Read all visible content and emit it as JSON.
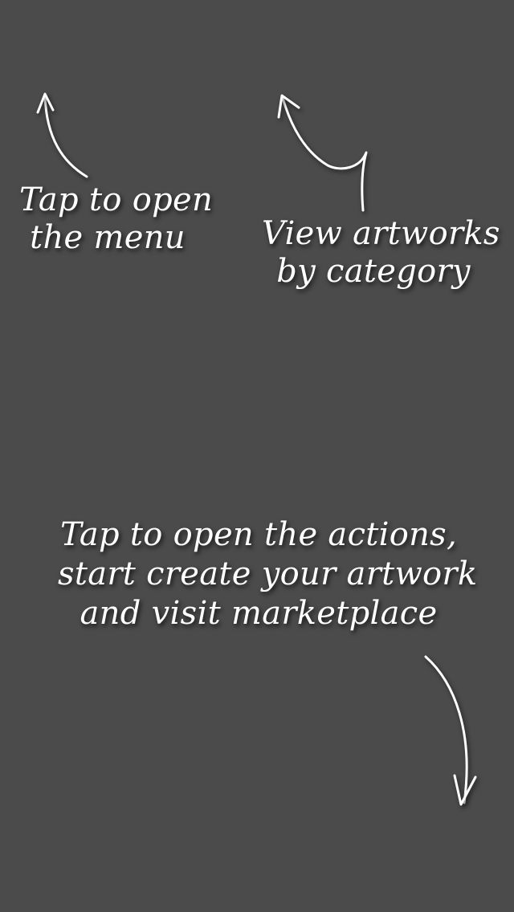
{
  "onboarding": {
    "menu_hint": {
      "line1": "Tap to open",
      "line2": "the menu"
    },
    "category_hint": {
      "line1": "View artworks",
      "line2": "by category"
    },
    "actions_hint": {
      "line1": "Tap to open the actions,",
      "line2": "start create your artwork",
      "line3": "and visit marketplace"
    },
    "arrows": [
      {
        "name": "menu-arrow-icon",
        "points_to": "menu"
      },
      {
        "name": "category-arrow-icon",
        "points_to": "category"
      },
      {
        "name": "actions-arrow-icon",
        "points_to": "actions"
      }
    ],
    "colors": {
      "background": "#4b4b4b",
      "text": "#ffffff"
    }
  }
}
